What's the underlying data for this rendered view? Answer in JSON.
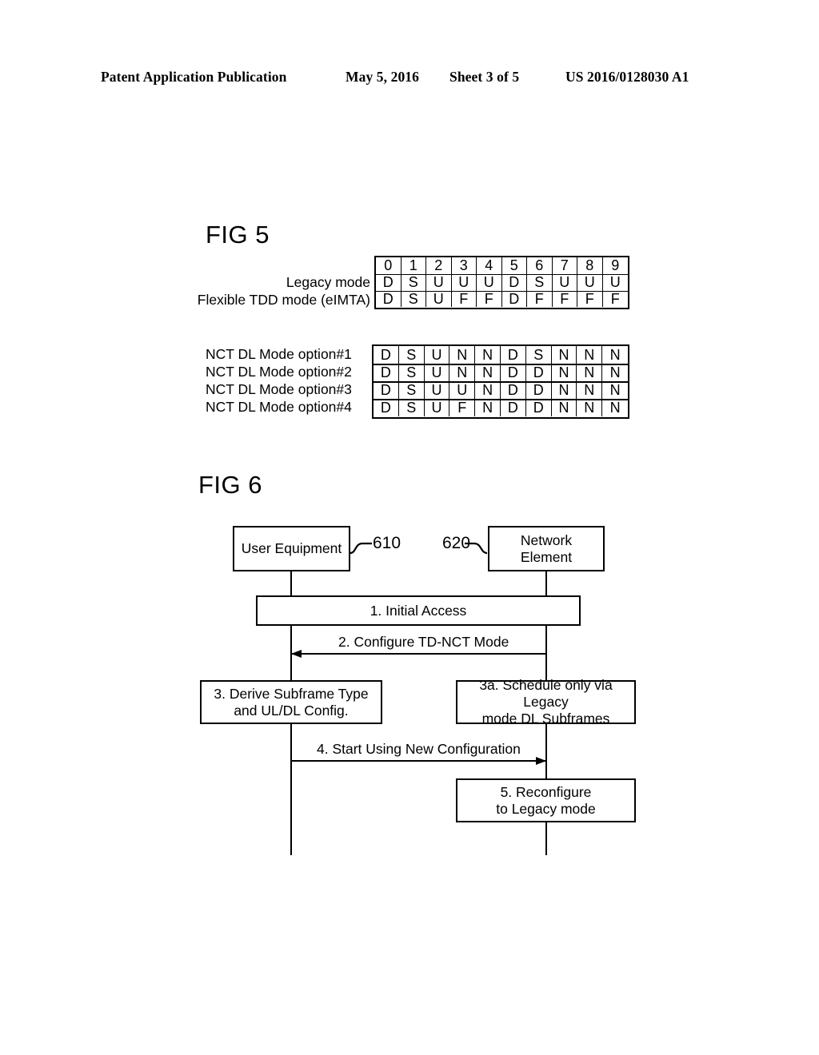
{
  "header": {
    "publication": "Patent Application Publication",
    "date": "May 5, 2016",
    "sheet": "Sheet 3 of 5",
    "number": "US 2016/0128030 A1"
  },
  "fig5": {
    "title": "FIG 5",
    "subframe_index_header": [
      "0",
      "1",
      "2",
      "3",
      "4",
      "5",
      "6",
      "7",
      "8",
      "9"
    ],
    "table1": {
      "rows": [
        {
          "label": "Legacy mode",
          "cells": [
            "D",
            "S",
            "U",
            "U",
            "U",
            "D",
            "S",
            "U",
            "U",
            "U"
          ]
        },
        {
          "label": "Flexible TDD mode (eIMTA)",
          "cells": [
            "D",
            "S",
            "U",
            "F",
            "F",
            "D",
            "F",
            "F",
            "F",
            "F"
          ]
        }
      ]
    },
    "table2": {
      "rows": [
        {
          "label": "NCT DL Mode option#1",
          "cells": [
            "D",
            "S",
            "U",
            "N",
            "N",
            "D",
            "S",
            "N",
            "N",
            "N"
          ]
        },
        {
          "label": "NCT DL Mode option#2",
          "cells": [
            "D",
            "S",
            "U",
            "N",
            "N",
            "D",
            "D",
            "N",
            "N",
            "N"
          ]
        },
        {
          "label": "NCT DL Mode option#3",
          "cells": [
            "D",
            "S",
            "U",
            "U",
            "N",
            "D",
            "D",
            "N",
            "N",
            "N"
          ]
        },
        {
          "label": "NCT DL Mode option#4",
          "cells": [
            "D",
            "S",
            "U",
            "F",
            "N",
            "D",
            "D",
            "N",
            "N",
            "N"
          ]
        }
      ]
    }
  },
  "fig6": {
    "title": "FIG 6",
    "actors": {
      "left": {
        "label": "User Equipment",
        "ref": "610"
      },
      "right": {
        "label": "Network\nElement",
        "line1": "Network",
        "line2": "Element",
        "ref": "620"
      }
    },
    "steps": [
      {
        "id": "step1",
        "kind": "box-span",
        "label": "1. Initial Access"
      },
      {
        "id": "step2",
        "kind": "arrow-left",
        "label": "2. Configure TD-NCT Mode"
      },
      {
        "id": "step3",
        "kind": "box-left",
        "line1": "3. Derive Subframe Type",
        "line2": "and UL/DL Config."
      },
      {
        "id": "step3a",
        "kind": "box-right",
        "line1": "3a. Schedule only via Legacy",
        "line2": "mode DL Subframes"
      },
      {
        "id": "step4",
        "kind": "arrow-right",
        "label": "4. Start Using New Configuration"
      },
      {
        "id": "step5",
        "kind": "box-right",
        "line1": "5. Reconfigure",
        "line2": "to Legacy mode"
      }
    ]
  },
  "colors": {
    "ink": "#000000",
    "paper": "#ffffff"
  }
}
